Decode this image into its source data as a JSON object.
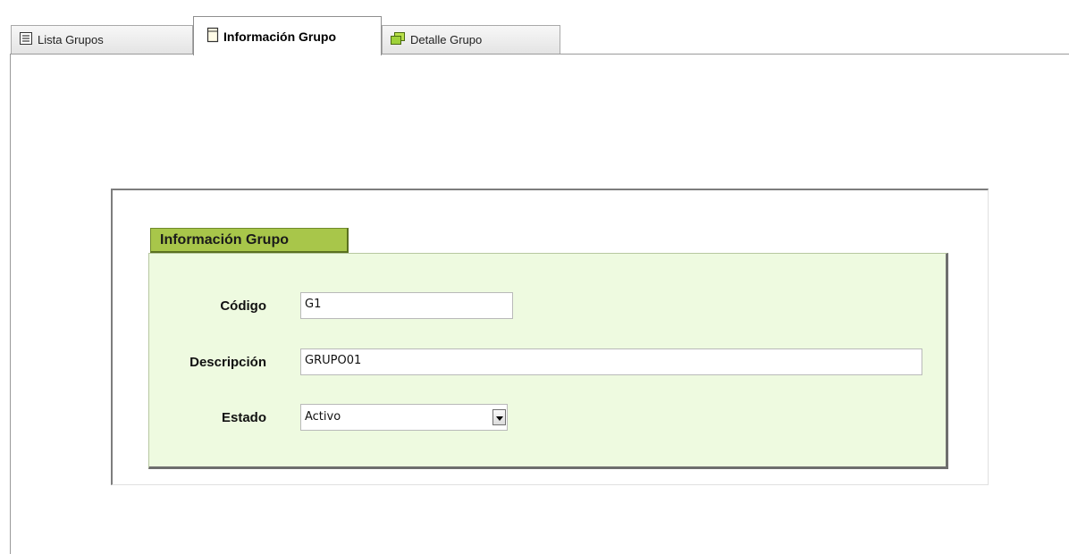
{
  "tabs": [
    {
      "label": "Lista Grupos",
      "icon": "list-icon",
      "active": false
    },
    {
      "label": "Información Grupo",
      "icon": "document-icon",
      "active": true
    },
    {
      "label": "Detalle Grupo",
      "icon": "detail-windows-icon",
      "active": false
    }
  ],
  "section": {
    "title": "Información Grupo"
  },
  "form": {
    "codigo": {
      "label": "Código",
      "value": "G1"
    },
    "descripcion": {
      "label": "Descripción",
      "value": "GRUPO01"
    },
    "estado": {
      "label": "Estado",
      "value": "Activo"
    }
  },
  "colors": {
    "section_header": "#a8c64a",
    "form_background": "#eefae0",
    "tab_background": "#e4e4e4"
  }
}
